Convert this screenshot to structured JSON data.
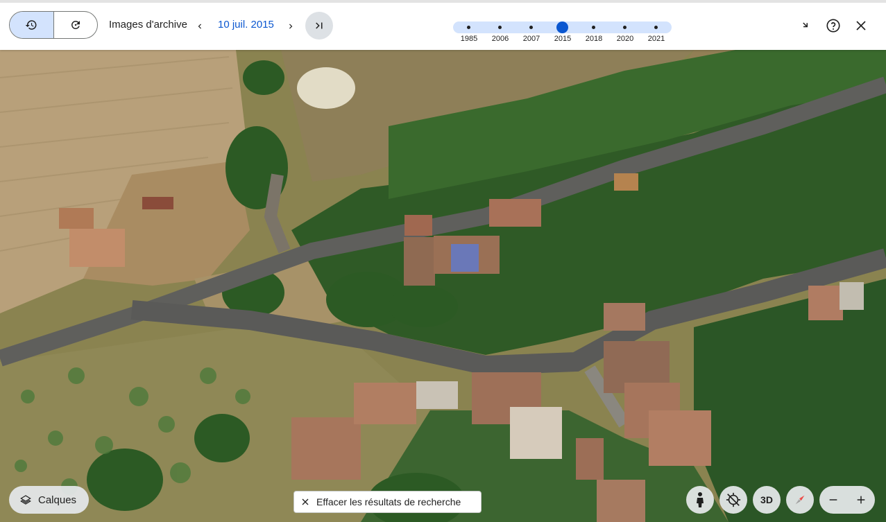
{
  "toolbar": {
    "history_icon": "history-icon",
    "restore_icon": "restore-icon",
    "archive_label": "Images d'archive",
    "date": "10 juil. 2015",
    "prev_icon": "chevron-left-icon",
    "next_icon": "chevron-right-icon",
    "last_icon": "skip-to-latest-icon"
  },
  "timeline": {
    "years": [
      "1985",
      "2006",
      "2007",
      "2015",
      "2018",
      "2020",
      "2021"
    ],
    "selected": "2015",
    "track_color": "#d3e3fd",
    "selected_color": "#0b57d0"
  },
  "top_right": {
    "collapse_icon": "collapse-icon",
    "help_icon": "help-icon",
    "close_icon": "close-icon"
  },
  "bottom": {
    "layers_label": "Calques",
    "clear_search_label": "Effacer les résultats de recherche",
    "threed_label": "3D",
    "pegman_icon": "pegman-icon",
    "location_icon": "location-off-icon",
    "compass_icon": "compass-icon",
    "zoom_out_icon": "minus-icon",
    "zoom_in_icon": "plus-icon"
  }
}
